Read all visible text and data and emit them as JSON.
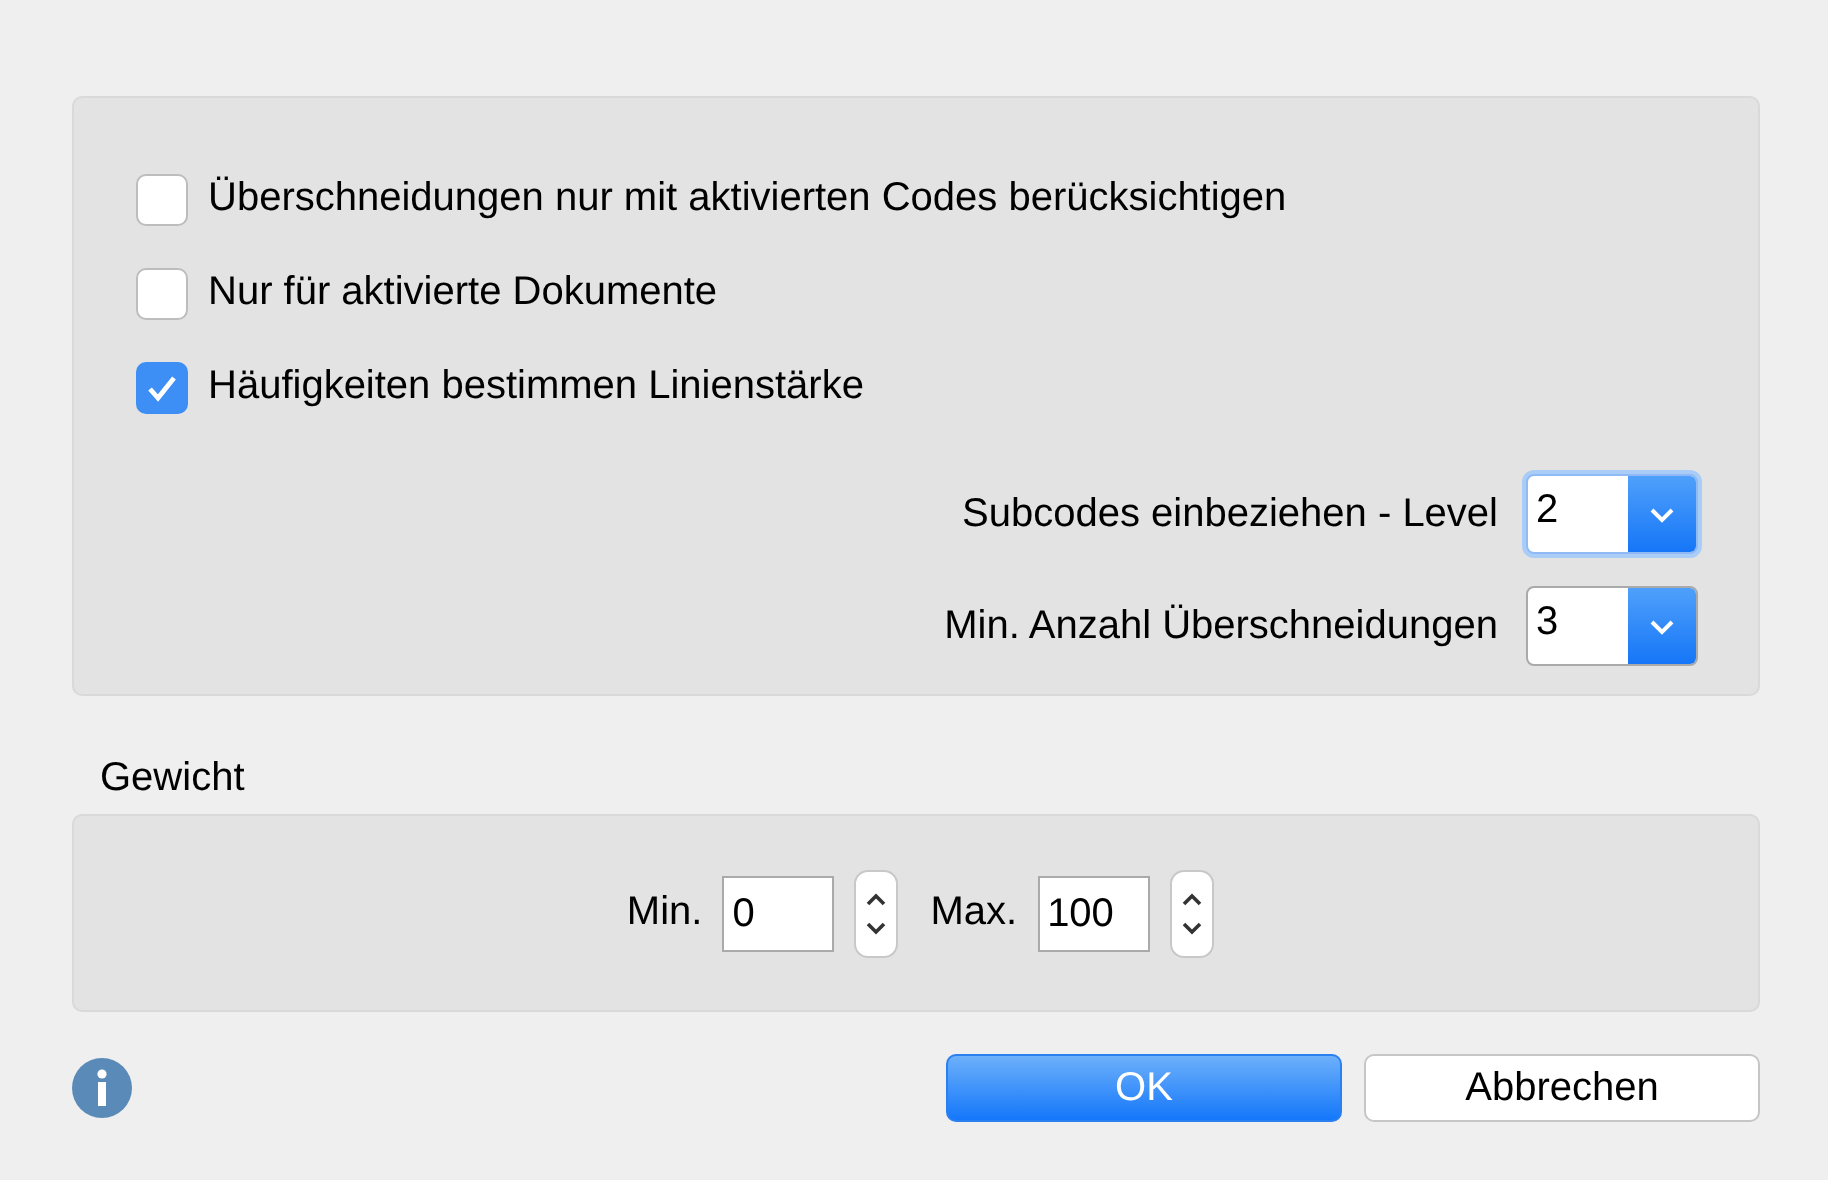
{
  "options": {
    "checkboxes": [
      {
        "label": "Überschneidungen nur mit aktivierten Codes berücksichtigen",
        "checked": false
      },
      {
        "label": "Nur für aktivierte Dokumente",
        "checked": false
      },
      {
        "label": "Häufigkeiten bestimmen Linienstärke",
        "checked": true
      }
    ],
    "dropdowns": [
      {
        "label": "Subcodes einbeziehen - Level",
        "value": "2",
        "focused": true
      },
      {
        "label": "Min. Anzahl Überschneidungen",
        "value": "3",
        "focused": false
      }
    ]
  },
  "weight": {
    "title": "Gewicht",
    "fields": [
      {
        "label": "Min.",
        "value": "0"
      },
      {
        "label": "Max.",
        "value": "100"
      }
    ]
  },
  "buttons": [
    {
      "label": "OK",
      "kind": "primary"
    },
    {
      "label": "Abbrechen",
      "kind": "secondary"
    }
  ]
}
